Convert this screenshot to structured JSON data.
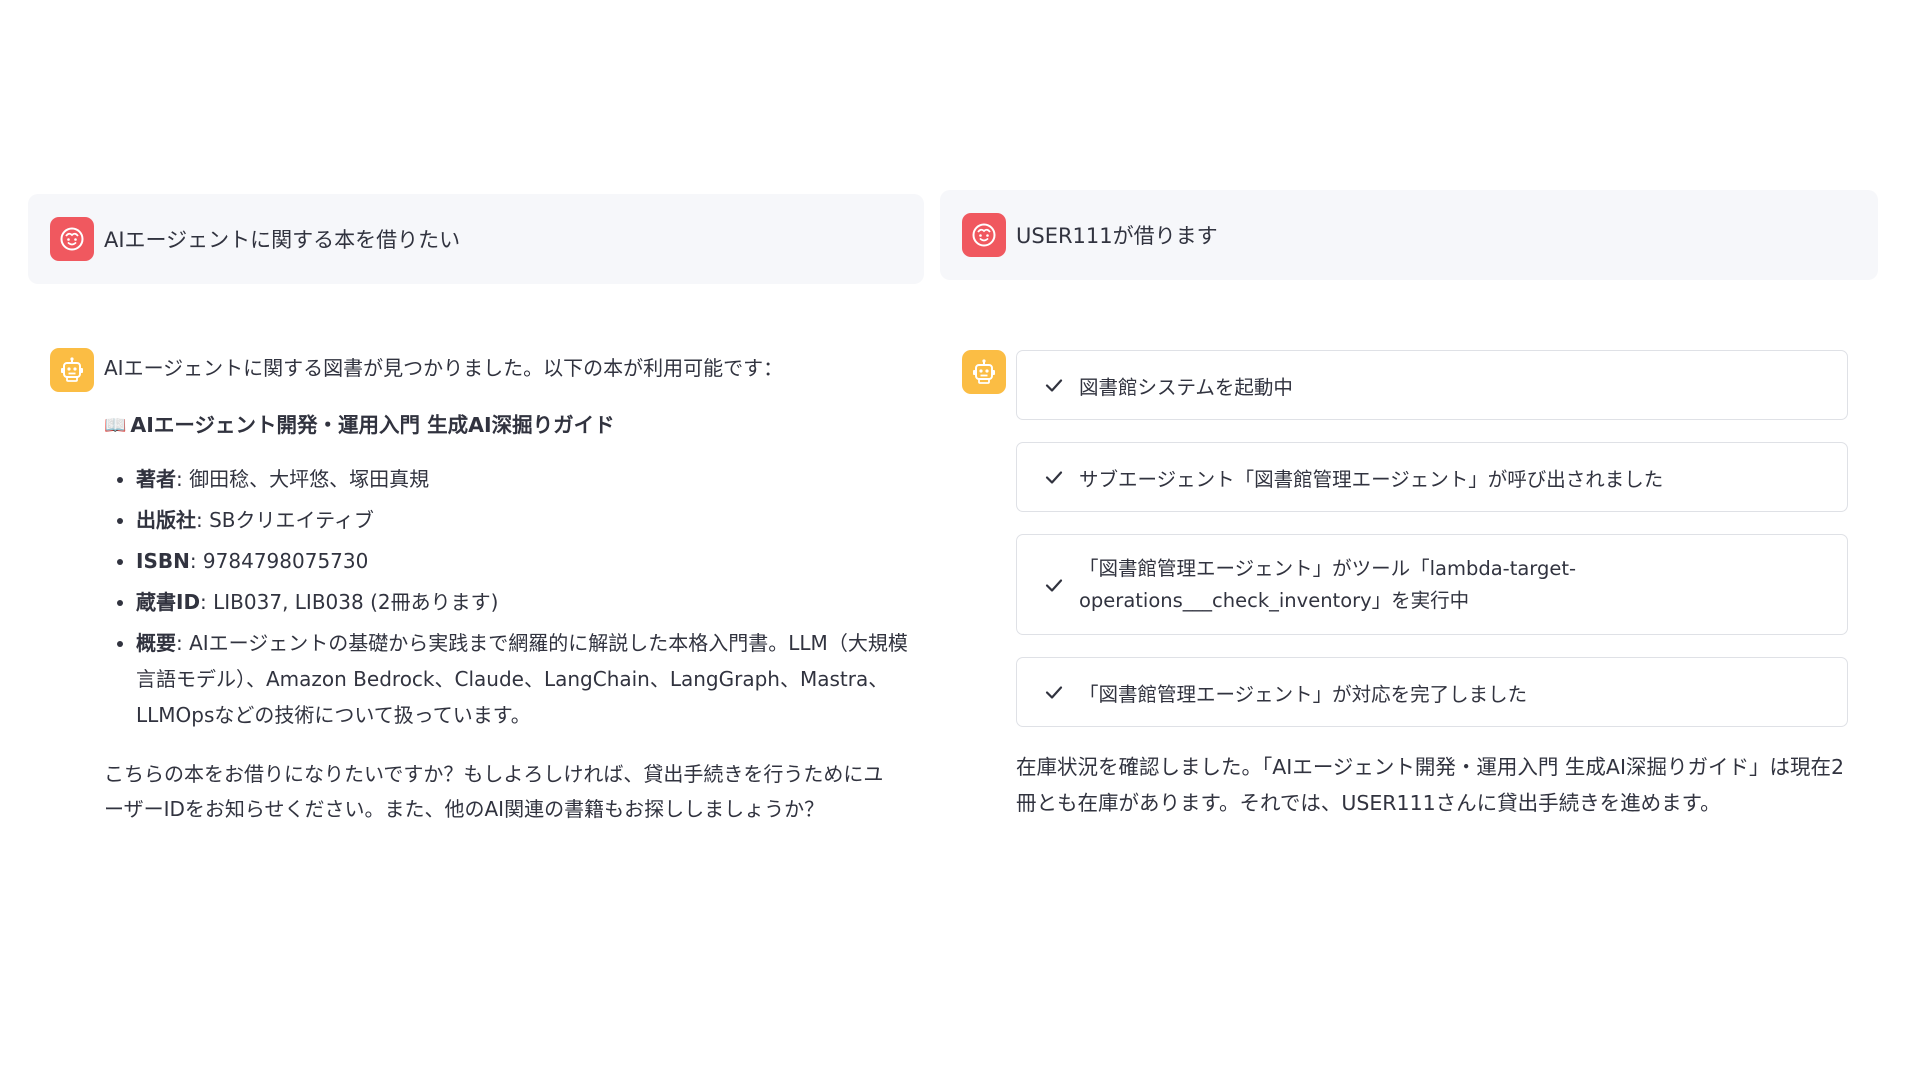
{
  "left": {
    "user_message": "AIエージェントに関する本を借りたい",
    "bot": {
      "intro": "AIエージェントに関する図書が見つかりました。以下の本が利用可能です：",
      "book_icon": "📖",
      "book_title": "AIエージェント開発・運用入門 生成AI深掘りガイド",
      "details": [
        {
          "label": "著者",
          "value": ": 御田稔、大坪悠、塚田真規"
        },
        {
          "label": "出版社",
          "value": ": SBクリエイティブ"
        },
        {
          "label": "ISBN",
          "value": ": 9784798075730"
        },
        {
          "label": "蔵書ID",
          "value": ": LIB037, LIB038 (2冊あります)"
        },
        {
          "label": "概要",
          "value": ": AIエージェントの基礎から実践まで網羅的に解説した本格入門書。LLM（大規模言語モデル）、Amazon Bedrock、Claude、LangChain、LangGraph、Mastra、LLMOpsなどの技術について扱っています。"
        }
      ],
      "closing": "こちらの本をお借りになりたいですか？もしよろしければ、貸出手続きを行うためにユーザーIDをお知らせください。また、他のAI関連の書籍もお探ししましょうか？"
    }
  },
  "right": {
    "user_message": "USER111が借ります",
    "steps": [
      {
        "line1": "図書館システムを起動中",
        "line2": ""
      },
      {
        "line1": "サブエージェント「図書館管理エージェント」が呼び出されました",
        "line2": ""
      },
      {
        "line1": "「図書館管理エージェント」がツール「lambda-target-",
        "line2": "operations___check_inventory」を実行中"
      },
      {
        "line1": "「図書館管理エージェント」が対応を完了しました",
        "line2": ""
      }
    ],
    "result": "在庫状況を確認しました。「AIエージェント開発・運用入門 生成AI深掘りガイド」は現在2冊とも在庫があります。それでは、USER111さんに貸出手続きを進めます。"
  },
  "colors": {
    "user_avatar": "#f0585f",
    "bot_avatar": "#fbbd44",
    "user_bubble": "#f6f7fa",
    "step_border": "#dfe1e6",
    "text": "#31333f"
  },
  "icons": {
    "user_avatar": "smiley-face-icon",
    "bot_avatar": "robot-icon",
    "step_status": "checkmark-icon",
    "book": "open-book-icon"
  }
}
